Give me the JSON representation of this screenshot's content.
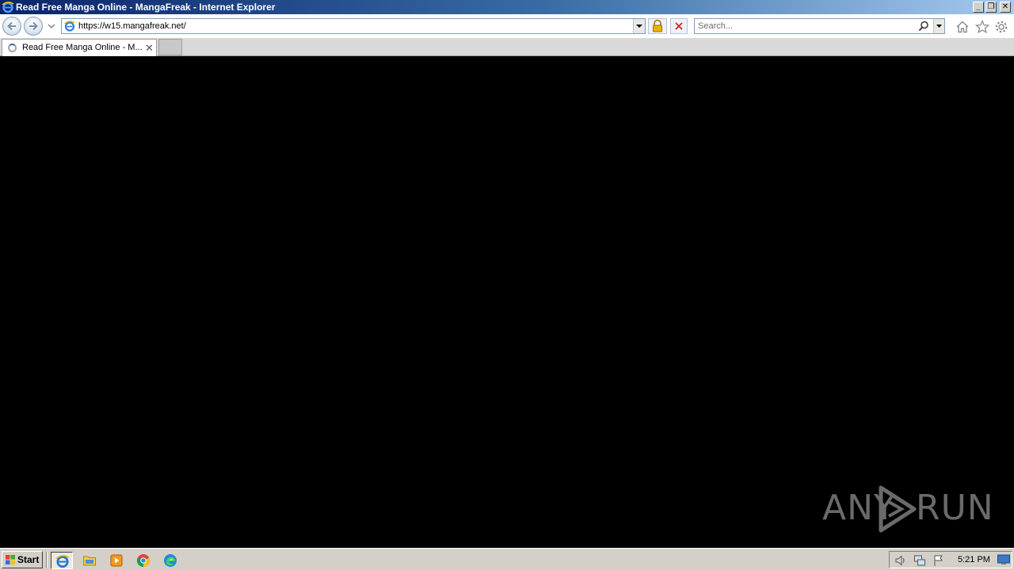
{
  "window": {
    "title": "Read Free Manga Online - MangaFreak - Internet Explorer",
    "minimize_glyph": "_",
    "restore_glyph": "❐",
    "close_glyph": "✕"
  },
  "navbar": {
    "address_value": "https://w15.mangafreak.net/",
    "search_placeholder": "Search..."
  },
  "tabs": [
    {
      "label": "Read Free Manga Online - M...",
      "close_glyph": "✕",
      "loading": true
    }
  ],
  "watermark": {
    "left_text": "ANY",
    "right_text": "RUN"
  },
  "taskbar": {
    "start_label": "Start",
    "pinned": [
      "internet-explorer-icon",
      "file-explorer-icon",
      "media-player-icon",
      "chrome-icon",
      "edge-icon"
    ],
    "clock": "5:21 PM"
  },
  "colors": {
    "titlebar_start": "#0a246a",
    "titlebar_end": "#a6caf0",
    "content_bg": "#000000",
    "taskbar_bg": "#d4d0c8"
  }
}
